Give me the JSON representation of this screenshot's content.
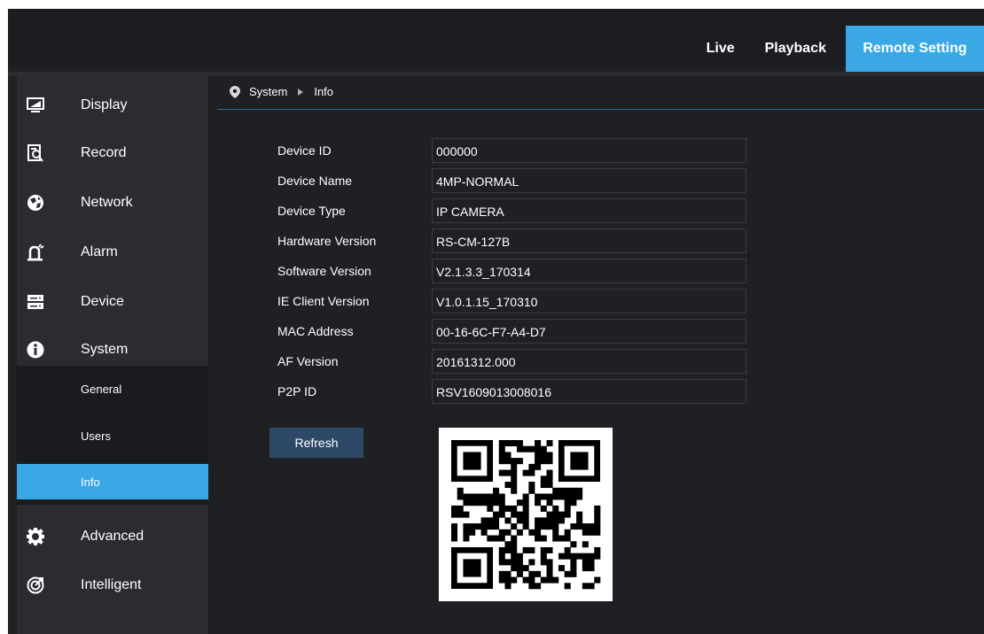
{
  "topnav": {
    "live": "Live",
    "playback": "Playback",
    "remote_setting": "Remote Setting",
    "active_color": "#3aa8e4"
  },
  "sidebar": {
    "items": [
      {
        "label": "Display",
        "icon": "display-icon"
      },
      {
        "label": "Record",
        "icon": "record-icon"
      },
      {
        "label": "Network",
        "icon": "network-icon"
      },
      {
        "label": "Alarm",
        "icon": "alarm-icon"
      },
      {
        "label": "Device",
        "icon": "device-icon"
      },
      {
        "label": "System",
        "icon": "info-icon"
      },
      {
        "label": "Advanced",
        "icon": "gear-icon"
      },
      {
        "label": "Intelligent",
        "icon": "intelligent-icon"
      }
    ],
    "system_sub": [
      {
        "label": "General"
      },
      {
        "label": "Users"
      },
      {
        "label": "Info",
        "active": true
      }
    ]
  },
  "breadcrumb": {
    "icon": "location-pin-icon",
    "section": "System",
    "page": "Info"
  },
  "info": {
    "fields": [
      {
        "label": "Device ID",
        "value": "000000"
      },
      {
        "label": "Device Name",
        "value": "4MP-NORMAL"
      },
      {
        "label": "Device Type",
        "value": "IP CAMERA"
      },
      {
        "label": "Hardware Version",
        "value": "RS-CM-127B"
      },
      {
        "label": "Software Version",
        "value": "V2.1.3.3_170314"
      },
      {
        "label": "IE Client Version",
        "value": "V1.0.1.15_170310"
      },
      {
        "label": "MAC Address",
        "value": "00-16-6C-F7-A4-D7"
      },
      {
        "label": "AF Version",
        "value": "20161312.000"
      },
      {
        "label": "P2P ID",
        "value": "RSV1609013008016"
      }
    ],
    "refresh_label": "Refresh"
  }
}
